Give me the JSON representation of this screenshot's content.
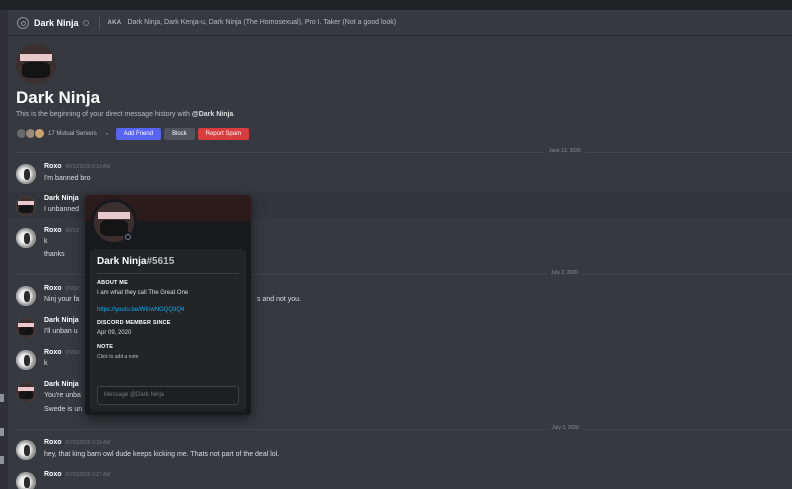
{
  "header": {
    "name": "Dark Ninja",
    "aka_label": "AKA",
    "aka_names": "Dark Ninja, Dark Kenja-u, Dark Ninja (The Homosexual), Pro I. Taker (Not a good look)"
  },
  "intro": {
    "title": "Dark Ninja",
    "subtitle_prefix": "This is the beginning of your direct message history with ",
    "subtitle_user": "@Dark Ninja",
    "subtitle_suffix": ".",
    "mutual_servers": "17 Mutual Servers",
    "add_friend": "Add Friend",
    "block": "Block",
    "report_spam": "Report Spam"
  },
  "dates": [
    "June 12, 2020",
    "July 2, 2020",
    "July 3, 2020"
  ],
  "messages": [
    {
      "author": "Roxo",
      "time": "06/12/2020 6:19 AM",
      "lines": [
        "I'm banned bro"
      ]
    },
    {
      "author": "Dark Ninja",
      "time": "",
      "lines": [
        "I unbanned"
      ]
    },
    {
      "author": "Roxo",
      "time": "06/12/",
      "lines": [
        "k",
        "thanks"
      ]
    },
    {
      "author": "Roxo",
      "time": "07/02/",
      "lines": [
        "Ninj your fa",
        "s and not you."
      ]
    },
    {
      "author": "Dark Ninja",
      "time": "",
      "lines": [
        "I'll unban u"
      ]
    },
    {
      "author": "Roxo",
      "time": "07/02/",
      "lines": [
        "k"
      ]
    },
    {
      "author": "Dark Ninja",
      "time": "",
      "lines": [
        "You're unba",
        "Swede is un"
      ]
    },
    {
      "author": "Roxo",
      "time": "07/03/2020 3:16 AM",
      "lines": [
        "hey, that king barn owl dude keeps kicking me. Thats not part of the deal lol."
      ]
    },
    {
      "author": "Roxo",
      "time": "07/03/2020 3:27 AM",
      "lines": []
    }
  ],
  "popout": {
    "name": "Dark Ninja",
    "tag": "#5615",
    "about_heading": "ABOUT ME",
    "about_text": "I am what they call The Great One",
    "link": "https://youtu.be/WInwNGQQ3Q4",
    "member_since_heading": "DISCORD MEMBER SINCE",
    "member_since": "Apr 09, 2020",
    "note_heading": "NOTE",
    "note_placeholder": "Click to add a note",
    "message_placeholder": "Message @Dark Ninja"
  },
  "colors": {
    "background": "#36393f",
    "blurple": "#5865f2",
    "danger": "#d83c3e",
    "link": "#00aff4",
    "popout_bg": "#18191c"
  }
}
